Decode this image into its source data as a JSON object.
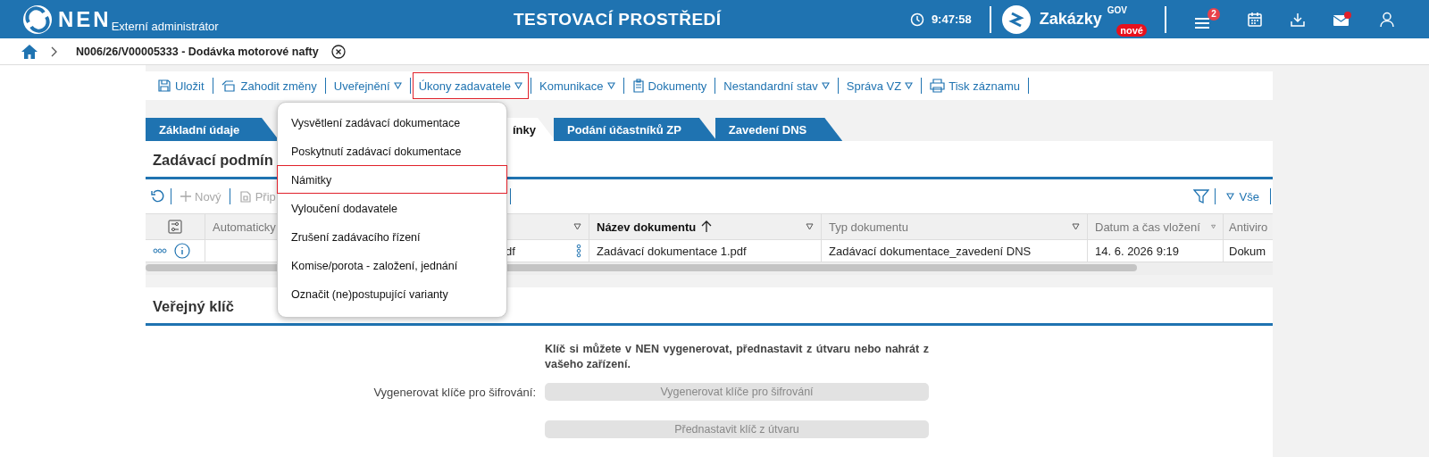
{
  "header": {
    "product": "NEN",
    "role": "Externí administrátor",
    "environment": "TESTOVACÍ PROSTŘEDÍ",
    "time": "9:47:58",
    "portal": {
      "name": "Zakázky",
      "sup": "GOV",
      "badge": "nové"
    },
    "menu_badge": "2",
    "mail_unread": true
  },
  "breadcrumb": {
    "title": "N006/26/V00005333 - Dodávka motorové nafty"
  },
  "toolbar": [
    {
      "label": "Uložit",
      "dropdown": false,
      "selected": false
    },
    {
      "label": "Zahodit změny",
      "dropdown": false,
      "selected": false
    },
    {
      "label": "Uveřejnění",
      "dropdown": true,
      "selected": false
    },
    {
      "label": "Úkony zadavatele",
      "dropdown": true,
      "selected": true
    },
    {
      "label": "Komunikace",
      "dropdown": true,
      "selected": false
    },
    {
      "label": "Dokumenty",
      "dropdown": false,
      "selected": false
    },
    {
      "label": "Nestandardní stav",
      "dropdown": true,
      "selected": false
    },
    {
      "label": "Správa VZ",
      "dropdown": true,
      "selected": false
    },
    {
      "label": "Tisk záznamu",
      "dropdown": false,
      "selected": false
    }
  ],
  "menu": [
    {
      "label": "Vysvětlení zadávací dokumentace",
      "selected": false
    },
    {
      "label": "Poskytnutí zadávací dokumentace",
      "selected": false
    },
    {
      "label": "Námitky",
      "selected": true
    },
    {
      "label": "Vyloučení dodavatele",
      "selected": false
    },
    {
      "label": "Zrušení zadávacího řízení",
      "selected": false
    },
    {
      "label": "Komise/porota - založení, jednání",
      "selected": false
    },
    {
      "label": "Označit (ne)postupující varianty",
      "selected": false
    }
  ],
  "tabs": [
    {
      "label": "Základní údaje",
      "selected": false
    },
    {
      "label": "ínky",
      "selected": true
    },
    {
      "label": "Podání účastníků ZP",
      "selected": false
    },
    {
      "label": "Zavedení DNS",
      "selected": false
    }
  ],
  "documents": {
    "title": "Zadávací podmín",
    "actions": [
      {
        "label": "Nový",
        "disabled": true
      },
      {
        "label": "Přip",
        "disabled": true
      }
    ],
    "filter_label": "Vše",
    "columns": [
      {
        "kind": "settings",
        "filter": false
      },
      {
        "kind": "text",
        "label": "Automaticky"
      },
      {
        "kind": "text",
        "filter": true
      },
      {
        "kind": "text",
        "label": "Název dokumentu",
        "sorted": true,
        "filter": true
      },
      {
        "kind": "text",
        "label": "Typ dokumentu",
        "filter": true
      },
      {
        "kind": "text",
        "label": "Datum a čas vložení",
        "filter": true
      },
      {
        "kind": "text",
        "label": "Antiviro"
      }
    ],
    "rows": [
      {
        "cells": [
          "",
          "",
          "df",
          "Zadávací dokumentace 1.pdf",
          "Zadávací dokumentace_zavedení DNS",
          "14. 6. 2026 9:19",
          "Dokum"
        ]
      }
    ]
  },
  "public_key": {
    "title": "Veřejný klíč",
    "note": "Klíč si můžete v NEN vygenerovat, přednastavit z útvaru nebo nahrát z vašeho zařízení.",
    "rows": [
      {
        "label": "Vygenerovat klíče pro šifrování:",
        "button": "Vygenerovat klíče pro šifrování",
        "disabled": true
      },
      {
        "button": "Přednastavit klíč z útvaru",
        "disabled": true
      }
    ]
  }
}
